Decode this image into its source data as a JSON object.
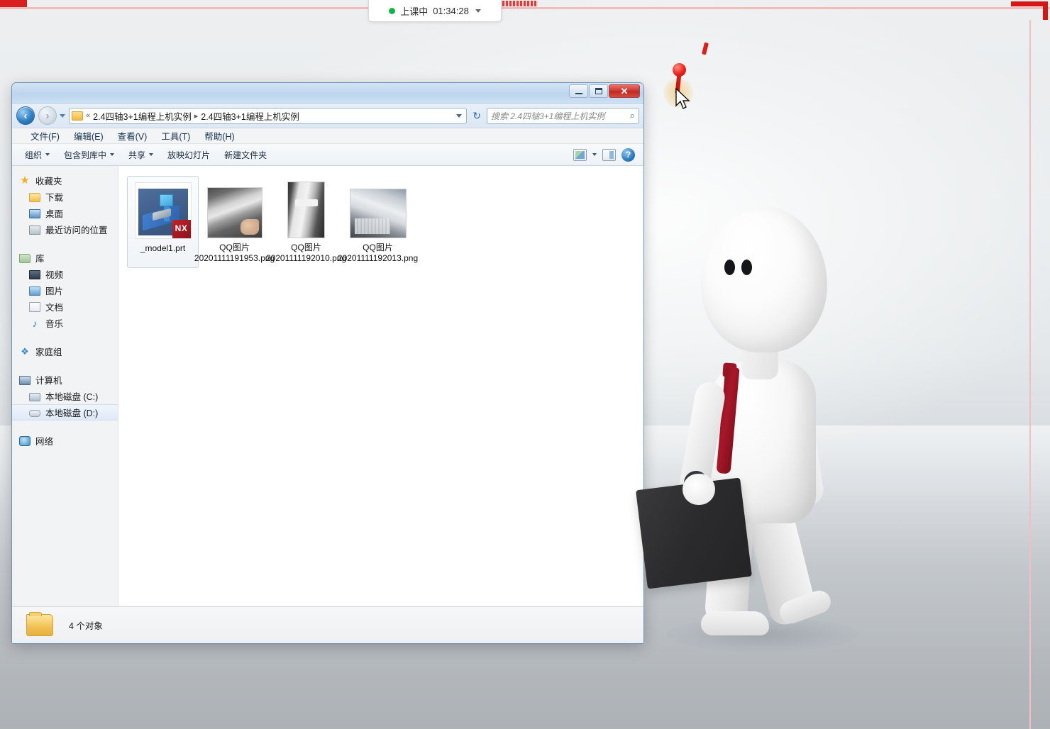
{
  "status_pill": {
    "label": "上课中",
    "timer": "01:34:28",
    "dot_color": "#16b34a",
    "caret_icon": "chevron-down-icon"
  },
  "window": {
    "title": "",
    "controls": {
      "minimize": "—",
      "maximize": "▢",
      "close": "✕"
    },
    "nav": {
      "back_icon": "back-arrow-icon",
      "forward_icon": "forward-arrow-icon",
      "history_icon": "chevron-down-icon",
      "refresh_icon": "refresh-icon",
      "address_chevron": "«",
      "address_separator": "▸",
      "address_segments": [
        "2.4四轴3+1编程上机实例",
        "2.4四轴3+1编程上机实例"
      ],
      "address_dropdown_icon": "chevron-down-icon",
      "folder_icon": "folder-icon"
    },
    "search": {
      "placeholder": "搜索 2.4四轴3+1编程上机实例",
      "value": "",
      "icon": "search-icon"
    },
    "menu": [
      {
        "label": "文件(F)"
      },
      {
        "label": "编辑(E)"
      },
      {
        "label": "查看(V)"
      },
      {
        "label": "工具(T)"
      },
      {
        "label": "帮助(H)"
      }
    ],
    "toolbar": {
      "items": [
        {
          "label": "组织",
          "has_caret": true
        },
        {
          "label": "包含到库中",
          "has_caret": true
        },
        {
          "label": "共享",
          "has_caret": true
        },
        {
          "label": "放映幻灯片",
          "has_caret": false
        },
        {
          "label": "新建文件夹",
          "has_caret": false
        }
      ],
      "right_icons": [
        {
          "name": "view-mode-icon"
        },
        {
          "name": "view-mode-caret-icon"
        },
        {
          "name": "preview-pane-icon"
        },
        {
          "name": "help-icon",
          "glyph": "?"
        }
      ]
    }
  },
  "sidebar": {
    "groups": [
      {
        "header": {
          "label": "收藏夹",
          "icon": "star-icon"
        },
        "items": [
          {
            "label": "下载",
            "icon": "folder-icon"
          },
          {
            "label": "桌面",
            "icon": "desktop-icon"
          },
          {
            "label": "最近访问的位置",
            "icon": "recent-places-icon"
          }
        ]
      },
      {
        "header": {
          "label": "库",
          "icon": "library-icon"
        },
        "items": [
          {
            "label": "视频",
            "icon": "video-icon"
          },
          {
            "label": "图片",
            "icon": "picture-icon"
          },
          {
            "label": "文档",
            "icon": "document-icon"
          },
          {
            "label": "音乐",
            "icon": "music-icon"
          }
        ]
      },
      {
        "header": {
          "label": "家庭组",
          "icon": "homegroup-icon"
        },
        "items": []
      },
      {
        "header": {
          "label": "计算机",
          "icon": "computer-icon"
        },
        "items": [
          {
            "label": "本地磁盘 (C:)",
            "icon": "hard-disk-icon",
            "selected": false
          },
          {
            "label": "本地磁盘 (D:)",
            "icon": "hard-disk-icon",
            "selected": true
          }
        ]
      },
      {
        "header": {
          "label": "网络",
          "icon": "network-icon"
        },
        "items": []
      }
    ]
  },
  "files": [
    {
      "name": "_model1.prt",
      "thumb": "nx-part-thumbnail",
      "badge": "NX",
      "selected": true
    },
    {
      "name": "QQ图片20201111191953.png",
      "thumb": "photo-machine-thumbnail",
      "selected": false
    },
    {
      "name": "QQ图片20201111192010.png",
      "thumb": "photo-part-thumbnail",
      "selected": false
    },
    {
      "name": "QQ图片20201111192013.png",
      "thumb": "photo-blueprint-thumbnail",
      "selected": false
    }
  ],
  "statusbar": {
    "icon": "folder-icon",
    "text": "4 个对象"
  },
  "annotations": {
    "pin_icon": "red-pin-marker",
    "cursor_icon": "mouse-cursor-arrow",
    "frame_color": "#d41616",
    "frame_line_color": "#f1bcbc"
  },
  "desktop": {
    "wallpaper": "3d-mannequin-with-briefcase",
    "figure_tie_color": "#9d1626",
    "briefcase_color": "#2b2b2d"
  }
}
